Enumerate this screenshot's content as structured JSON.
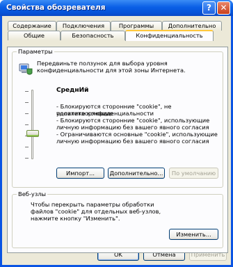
{
  "window": {
    "title": "Свойства обозревателя",
    "help_label": "?",
    "close_label": "✕"
  },
  "tabs": {
    "row1": [
      "Содержание",
      "Подключения",
      "Программы",
      "Дополнительно"
    ],
    "row2": [
      "Общие",
      "Безопасность",
      "Конфиденциальность"
    ],
    "active": "Конфиденциальность"
  },
  "settings": {
    "group_label": "Параметры",
    "instruction": [
      "Передвиньте ползунок для выбора уровня",
      "конфиденциальности для этой зоны Интернета."
    ],
    "level_name": "СреднИй",
    "level_lines": [
      "- Блокируются сторонние \"cookie\", не удовлетворяющие",
      "политике конфиденциальности",
      "- Блокируются сторонние \"cookie\", использующие",
      "личную информацию без вашего явного согласия",
      "- Ограничиваются основные \"cookie\", использующие",
      "личную информацию без вашего явного согласия"
    ],
    "import_label": "Импорт...",
    "advanced_label": "Дополнительно...",
    "default_label": "По умолчанию"
  },
  "websites": {
    "group_label": "Веб-узлы",
    "text": [
      "Чтобы перекрыть параметры обработки",
      "файлов \"cookie\" для отдельных веб-узлов,",
      "нажмите кнопку \"Изменить\"."
    ],
    "edit_label": "Изменить..."
  },
  "footer": {
    "ok_label": "OK",
    "cancel_label": "Отмена",
    "apply_label": "Применить"
  }
}
